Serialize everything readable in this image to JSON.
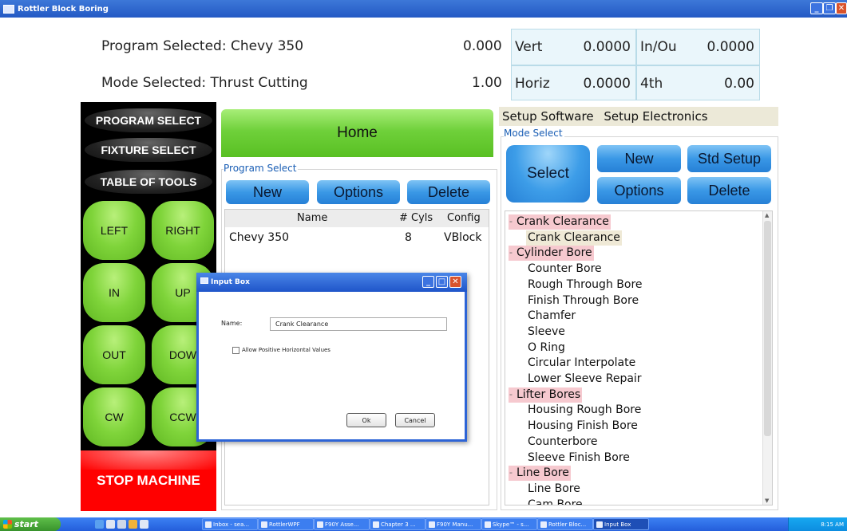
{
  "window": {
    "title": "Rottler Block Boring"
  },
  "header": {
    "program_selected": "Program Selected: Chevy 350",
    "mode_selected": "Mode Selected: Thrust Cutting",
    "value1": "0.000",
    "value2": "1.00",
    "readouts": [
      {
        "label": "Vert",
        "value": "0.0000"
      },
      {
        "label": "In/Ou",
        "value": "0.0000"
      },
      {
        "label": "Horiz",
        "value": "0.0000"
      },
      {
        "label": "4th",
        "value": "0.00"
      }
    ]
  },
  "left_panel": {
    "program_select": "PROGRAM SELECT",
    "fixture_select": "FIXTURE SELECT",
    "table_of_tools": "TABLE OF TOOLS",
    "jog": [
      "LEFT",
      "RIGHT",
      "IN",
      "UP",
      "OUT",
      "DOW",
      "CW",
      "CCW"
    ],
    "stop": "STOP MACHINE"
  },
  "home": {
    "label": "Home"
  },
  "program_select": {
    "group_label": "Program Select",
    "buttons": {
      "new": "New",
      "options": "Options",
      "delete": "Delete"
    },
    "columns": [
      "Name",
      "# Cyls",
      "Config"
    ],
    "rows": [
      {
        "name": "Chevy 350",
        "cyls": "8",
        "config": "VBlock"
      }
    ]
  },
  "tabs": {
    "software": "Setup Software",
    "electronics": "Setup Electronics"
  },
  "mode_select": {
    "group_label": "Mode Select",
    "buttons": {
      "select": "Select",
      "new": "New",
      "std_setup": "Std Setup",
      "options": "Options",
      "delete": "Delete"
    },
    "tree": [
      {
        "kind": "parent",
        "label": "Crank Clearance"
      },
      {
        "kind": "child-sel",
        "label": "Crank Clearance"
      },
      {
        "kind": "parent",
        "label": "Cylinder Bore"
      },
      {
        "kind": "child",
        "label": "Counter Bore"
      },
      {
        "kind": "child",
        "label": "Rough Through Bore"
      },
      {
        "kind": "child",
        "label": "Finish Through Bore"
      },
      {
        "kind": "child",
        "label": "Chamfer"
      },
      {
        "kind": "child",
        "label": "Sleeve"
      },
      {
        "kind": "child",
        "label": "O Ring"
      },
      {
        "kind": "child",
        "label": "Circular Interpolate"
      },
      {
        "kind": "child",
        "label": "Lower Sleeve Repair"
      },
      {
        "kind": "parent",
        "label": "Lifter Bores"
      },
      {
        "kind": "child",
        "label": "Housing Rough Bore"
      },
      {
        "kind": "child",
        "label": "Housing Finish Bore"
      },
      {
        "kind": "child",
        "label": "Counterbore"
      },
      {
        "kind": "child",
        "label": "Sleeve Finish Bore"
      },
      {
        "kind": "parent",
        "label": "Line Bore"
      },
      {
        "kind": "child",
        "label": "Line Bore"
      },
      {
        "kind": "child",
        "label": "Cam Bore"
      }
    ]
  },
  "dialog": {
    "title": "Input Box",
    "name_label": "Name:",
    "name_value": "Crank Clearance",
    "checkbox_label": "Allow Positive Horizontal Values",
    "ok": "Ok",
    "cancel": "Cancel"
  },
  "taskbar": {
    "start": "start",
    "tasks": [
      "Inbox - sea...",
      "RottlerWPF",
      "F90Y Asse...",
      "Chapter 3 ...",
      "F90Y Manu...",
      "Skype™ - s...",
      "Rottler Bloc...",
      "Input Box"
    ],
    "clock": "8:15 AM"
  }
}
